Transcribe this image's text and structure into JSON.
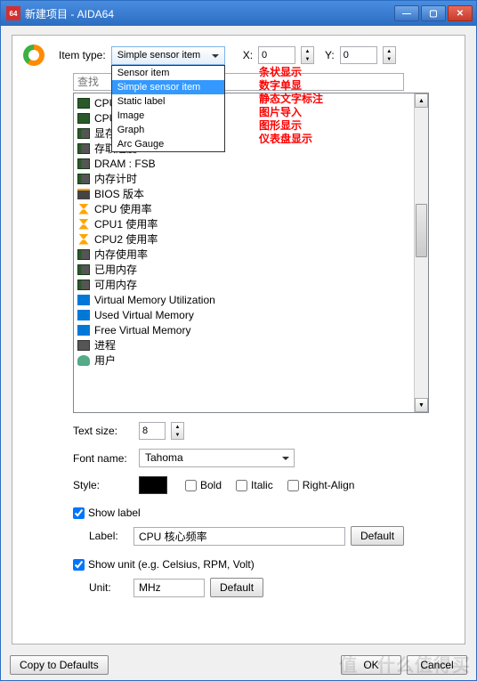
{
  "window": {
    "app_badge": "64",
    "title": "新建项目 - AIDA64"
  },
  "top": {
    "item_type_label": "Item type:",
    "item_type_value": "Simple sensor item",
    "options": [
      "Sensor item",
      "Simple sensor item",
      "Static label",
      "Image",
      "Graph",
      "Arc Gauge"
    ],
    "selected_index": 1,
    "annotations": [
      "条状显示",
      "数字单显",
      "静态文字标注",
      "图片导入",
      "图形显示",
      "仪表盘显示"
    ],
    "x_label": "X:",
    "x_value": "0",
    "y_label": "Y:",
    "y_value": "0"
  },
  "search": {
    "placeholder": "查找"
  },
  "items": [
    {
      "icon": "chip",
      "label": "CPU"
    },
    {
      "icon": "chip",
      "label": "CPU"
    },
    {
      "icon": "chip2",
      "label": "显存频率"
    },
    {
      "icon": "chip2",
      "label": "存取速度"
    },
    {
      "icon": "chip2",
      "label": "DRAM : FSB"
    },
    {
      "icon": "chip2",
      "label": "内存计时"
    },
    {
      "icon": "bios",
      "label": "BIOS 版本"
    },
    {
      "icon": "hour",
      "label": "CPU 使用率"
    },
    {
      "icon": "hour",
      "label": "CPU1 使用率"
    },
    {
      "icon": "hour",
      "label": "CPU2 使用率"
    },
    {
      "icon": "chip2",
      "label": "内存使用率"
    },
    {
      "icon": "chip2",
      "label": "已用内存"
    },
    {
      "icon": "chip2",
      "label": "可用内存"
    },
    {
      "icon": "win",
      "label": "Virtual Memory Utilization"
    },
    {
      "icon": "win",
      "label": "Used Virtual Memory"
    },
    {
      "icon": "win",
      "label": "Free Virtual Memory"
    },
    {
      "icon": "proc",
      "label": "进程"
    },
    {
      "icon": "user",
      "label": "用户"
    }
  ],
  "text_size": {
    "label": "Text size:",
    "value": "8"
  },
  "font": {
    "label": "Font name:",
    "value": "Tahoma"
  },
  "style": {
    "label": "Style:",
    "bold": "Bold",
    "italic": "Italic",
    "right": "Right-Align"
  },
  "show_label": {
    "check": "Show label",
    "label_label": "Label:",
    "value": "CPU 核心频率",
    "default": "Default"
  },
  "show_unit": {
    "check": "Show unit (e.g. Celsius, RPM, Volt)",
    "unit_label": "Unit:",
    "value": "MHz",
    "default": "Default"
  },
  "bottom": {
    "copy": "Copy to Defaults",
    "ok": "OK",
    "cancel": "Cancel"
  },
  "watermark": "值 ··什么值得买"
}
